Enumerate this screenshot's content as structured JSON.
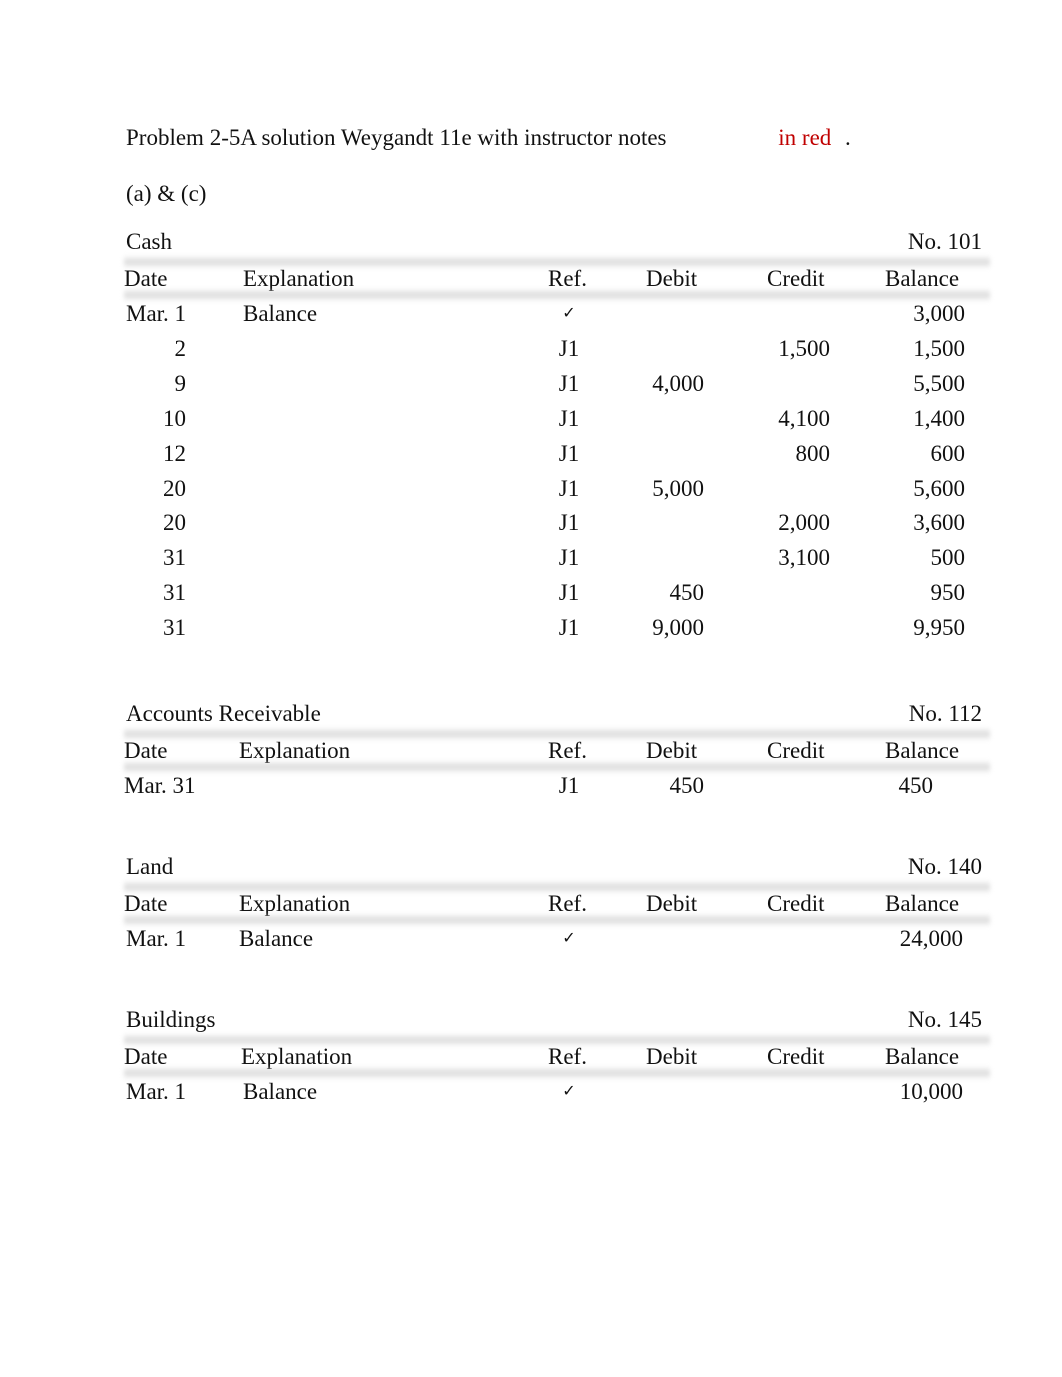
{
  "document": {
    "title_main": "Problem 2-5A solution Weygandt 11e with instructor notes",
    "title_red": "in red",
    "title_end": ".",
    "subtitle": "(a) & (c)"
  },
  "columns": [
    "Date",
    "Explanation",
    "Ref.",
    "Debit",
    "Credit",
    "Balance"
  ],
  "accounts": [
    {
      "name": "Cash",
      "number": "No. 101",
      "rows": [
        {
          "date": "Mar. 1",
          "explanation": "Balance",
          "ref": "✓",
          "debit": "",
          "credit": "",
          "balance": "3,000"
        },
        {
          "date": "2",
          "explanation": "",
          "ref": "J1",
          "debit": "",
          "credit": "1,500",
          "balance": "1,500"
        },
        {
          "date": "9",
          "explanation": "",
          "ref": "J1",
          "debit": "4,000",
          "credit": "",
          "balance": "5,500"
        },
        {
          "date": "10",
          "explanation": "",
          "ref": "J1",
          "debit": "",
          "credit": "4,100",
          "balance": "1,400"
        },
        {
          "date": "12",
          "explanation": "",
          "ref": "J1",
          "debit": "",
          "credit": "800",
          "balance": "600"
        },
        {
          "date": "20",
          "explanation": "",
          "ref": "J1",
          "debit": "5,000",
          "credit": "",
          "balance": "5,600"
        },
        {
          "date": "20",
          "explanation": "",
          "ref": "J1",
          "debit": "",
          "credit": "2,000",
          "balance": "3,600"
        },
        {
          "date": "31",
          "explanation": "",
          "ref": "J1",
          "debit": "",
          "credit": "3,100",
          "balance": "500"
        },
        {
          "date": "31",
          "explanation": "",
          "ref": "J1",
          "debit": "450",
          "credit": "",
          "balance": "950"
        },
        {
          "date": "31",
          "explanation": "",
          "ref": "J1",
          "debit": "9,000",
          "credit": "",
          "balance": "9,950"
        }
      ]
    },
    {
      "name": "Accounts Receivable",
      "number": "No. 112",
      "rows": [
        {
          "date": "Mar. 31",
          "explanation": "",
          "ref": "J1",
          "debit": "450",
          "credit": "",
          "balance": "450"
        }
      ]
    },
    {
      "name": "Land",
      "number": "No. 140",
      "rows": [
        {
          "date": "Mar. 1",
          "explanation": "Balance",
          "ref": "✓",
          "debit": "",
          "credit": "",
          "balance": "24,000"
        }
      ]
    },
    {
      "name": "Buildings",
      "number": "No. 145",
      "rows": [
        {
          "date": "Mar. 1",
          "explanation": "Balance",
          "ref": "✓",
          "debit": "",
          "credit": "",
          "balance": "10,000"
        }
      ]
    }
  ]
}
